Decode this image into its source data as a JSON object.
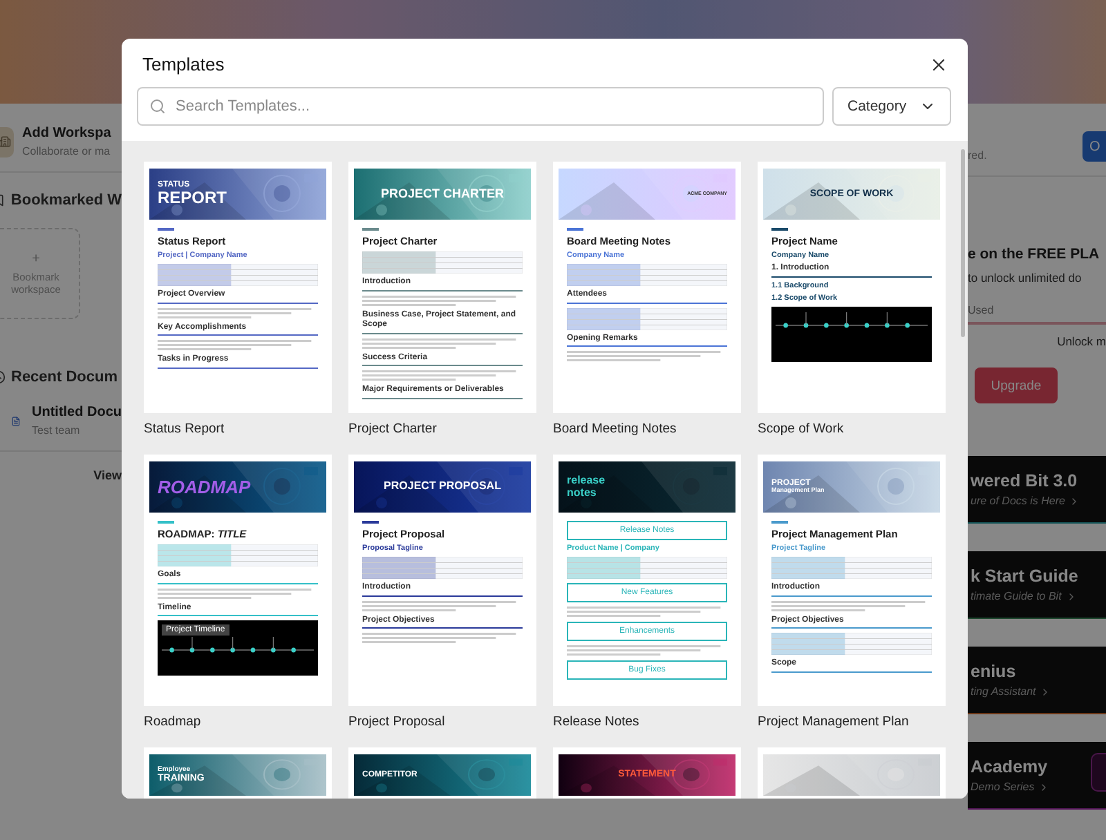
{
  "background": {
    "left": {
      "workspace_title": "Add Workspa",
      "workspace_hint": "Collaborate or ma",
      "bookmarks_title": "Bookmarked W",
      "bookmark_plus": "+",
      "bookmark_label": "Bookmark workspace",
      "recent_title": "Recent Docum",
      "recent_doc": {
        "title": "Untitled Docu",
        "team": "Test team"
      },
      "view_link": "View"
    },
    "right": {
      "cut_text": "red.",
      "button": "O",
      "plan_title": "e on the FREE PLA",
      "plan_text": "to unlock unlimited do",
      "used": "Used",
      "unlock": "Unlock m",
      "upgrade": "Upgrade",
      "cards": [
        {
          "title": "wered Bit 3.0",
          "subtitle": "ure of Docs is Here"
        },
        {
          "title": "k Start Guide",
          "subtitle": "timate Guide to Bit"
        },
        {
          "title": "enius",
          "subtitle": "ting Assistant"
        },
        {
          "title": "Academy",
          "subtitle": "Demo Series"
        }
      ]
    }
  },
  "modal": {
    "title": "Templates",
    "search": {
      "placeholder": "Search Templates..."
    },
    "category": "Category",
    "templates": [
      {
        "name": "Status Report",
        "kind": "status",
        "banner": [
          "STATUS",
          "REPORT"
        ],
        "blocks": [
          {
            "kind": "title",
            "text": "Status Report"
          },
          {
            "kind": "subtitle",
            "text": "Project | Company Name"
          },
          {
            "kind": "table"
          },
          {
            "kind": "heading",
            "text": "Project Overview"
          },
          {
            "kind": "lines"
          },
          {
            "kind": "heading",
            "text": "Key Accomplishments"
          },
          {
            "kind": "lines"
          },
          {
            "kind": "heading",
            "text": "Tasks in Progress"
          }
        ]
      },
      {
        "name": "Project Charter",
        "kind": "charter",
        "banner": [
          "PROJECT CHARTER"
        ],
        "blocks": [
          {
            "kind": "title",
            "text": "Project Charter"
          },
          {
            "kind": "table"
          },
          {
            "kind": "heading",
            "text": "Introduction"
          },
          {
            "kind": "lines"
          },
          {
            "kind": "heading",
            "text": "Business Case, Project Statement, and Scope"
          },
          {
            "kind": "lines"
          },
          {
            "kind": "heading",
            "text": "Success Criteria"
          },
          {
            "kind": "lines"
          },
          {
            "kind": "heading",
            "text": "Major Requirements or Deliverables"
          }
        ]
      },
      {
        "name": "Board Meeting Notes",
        "kind": "board",
        "banner": [
          "ACME COMPANY"
        ],
        "blocks": [
          {
            "kind": "title",
            "text": "Board Meeting Notes"
          },
          {
            "kind": "subtitle",
            "text": "Company Name"
          },
          {
            "kind": "table"
          },
          {
            "kind": "heading",
            "text": "Attendees"
          },
          {
            "kind": "table"
          },
          {
            "kind": "heading",
            "text": "Opening Remarks"
          },
          {
            "kind": "lines"
          }
        ]
      },
      {
        "name": "Scope of Work",
        "kind": "scope",
        "banner": [
          "SCOPE OF WORK"
        ],
        "blocks": [
          {
            "kind": "title",
            "text": "Project Name"
          },
          {
            "kind": "subtitle",
            "text": "Company Name"
          },
          {
            "kind": "heading",
            "text": "1. Introduction"
          },
          {
            "kind": "subtitle",
            "text": "1.1 Background"
          },
          {
            "kind": "subtitle",
            "text": "1.2 Scope of Work"
          },
          {
            "kind": "chart"
          }
        ]
      },
      {
        "name": "Roadmap",
        "kind": "roadmap",
        "banner": [
          "ROADMAP"
        ],
        "blocks": [
          {
            "kind": "title",
            "text": "ROADMAP: *TITLE*"
          },
          {
            "kind": "table"
          },
          {
            "kind": "heading",
            "text": "Goals"
          },
          {
            "kind": "lines"
          },
          {
            "kind": "heading",
            "text": "Timeline"
          },
          {
            "kind": "chart",
            "text": "Project Timeline"
          }
        ]
      },
      {
        "name": "Project Proposal",
        "kind": "proposal",
        "banner": [
          "PROJECT PROPOSAL"
        ],
        "blocks": [
          {
            "kind": "title",
            "text": "Project Proposal"
          },
          {
            "kind": "subtitle",
            "text": "Proposal Tagline"
          },
          {
            "kind": "table"
          },
          {
            "kind": "heading",
            "text": "Introduction"
          },
          {
            "kind": "lines"
          },
          {
            "kind": "heading",
            "text": "Project Objectives"
          },
          {
            "kind": "lines"
          }
        ]
      },
      {
        "name": "Release Notes",
        "kind": "release",
        "banner": [
          "release",
          "notes"
        ],
        "blocks": [
          {
            "kind": "boxed",
            "text": "Release Notes"
          },
          {
            "kind": "subtitle",
            "text": "Product Name | Company"
          },
          {
            "kind": "table"
          },
          {
            "kind": "boxed",
            "text": "New Features"
          },
          {
            "kind": "lines"
          },
          {
            "kind": "boxed",
            "text": "Enhancements"
          },
          {
            "kind": "lines"
          },
          {
            "kind": "boxed",
            "text": "Bug Fixes"
          }
        ]
      },
      {
        "name": "Project Management Plan",
        "kind": "plan",
        "banner": [
          "PROJECT",
          "Management Plan"
        ],
        "blocks": [
          {
            "kind": "title",
            "text": "Project Management Plan"
          },
          {
            "kind": "subtitle",
            "text": "Project Tagline"
          },
          {
            "kind": "table"
          },
          {
            "kind": "heading",
            "text": "Introduction"
          },
          {
            "kind": "lines"
          },
          {
            "kind": "heading",
            "text": "Project Objectives"
          },
          {
            "kind": "table"
          },
          {
            "kind": "heading",
            "text": "Scope"
          }
        ]
      },
      {
        "kind": "training",
        "banner": [
          "Employee",
          "TRAINING"
        ]
      },
      {
        "kind": "competitor",
        "banner": [
          "COMPETITOR"
        ]
      },
      {
        "kind": "statement",
        "banner": [
          "STATEMENT"
        ]
      },
      {
        "kind": "gears"
      }
    ]
  }
}
